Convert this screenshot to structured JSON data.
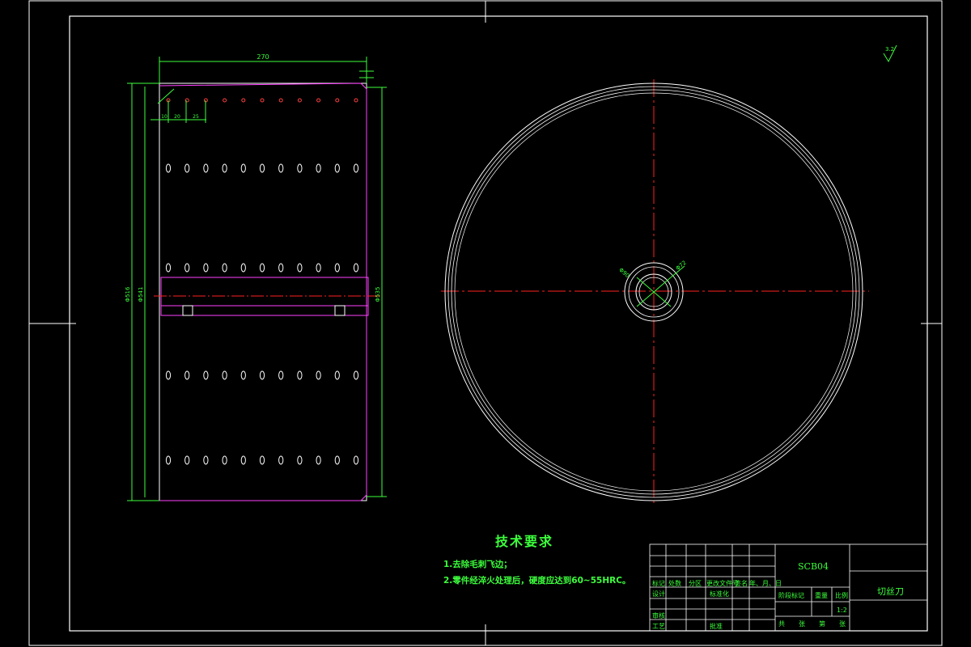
{
  "drawing": {
    "colors": {
      "background": "#000000",
      "frame": "#ffffff",
      "outline": "#ffffff",
      "section_edge": "#ff40ff",
      "centerline": "#ff2020",
      "dimension": "#3cff3c",
      "text": "#3cff3c"
    },
    "side_view": {
      "dim_length": "270",
      "dim_small_1": "10",
      "dim_small_2": "20",
      "dim_small_3": "25",
      "dim_dia_outer": "Φ516",
      "dim_dia_inner": "Φ541",
      "dim_dia_right": "Φ535",
      "hole_columns": 11,
      "hole_rows": 5
    },
    "front_view": {
      "hub_dim_1": "Φ90",
      "hub_dim_2": "Φ72"
    },
    "roughness": "3.2",
    "technical_requirements": {
      "title": "技术要求",
      "items": [
        "1.去除毛刺飞边；",
        "2.零件经淬火处理后，硬度应达到60~55HRC。"
      ]
    },
    "title_block": {
      "drawing_number": "SCB04",
      "part_name": "切丝刀",
      "scale_label": "比例",
      "scale_value": "1:2",
      "row_labels": [
        "标记",
        "处数",
        "分区",
        "更改文件号",
        "签名",
        "年、月、日"
      ],
      "roles": {
        "design": "设计",
        "standard": "标准化",
        "review": "审核",
        "process": "工艺",
        "approve": "批准"
      },
      "stage_label": "阶段标记",
      "weight_label": "重量",
      "sheet_labels": [
        "共",
        "张",
        "第",
        "张"
      ]
    }
  }
}
